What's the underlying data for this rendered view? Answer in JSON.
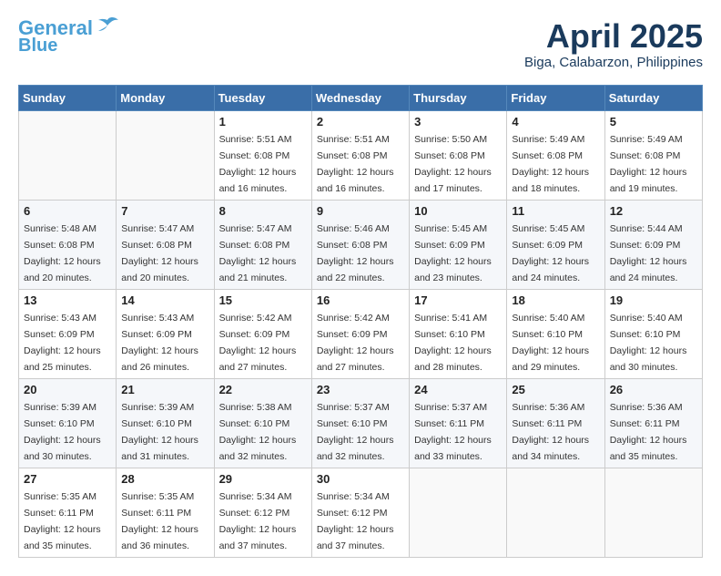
{
  "header": {
    "logo_line1": "General",
    "logo_line2": "Blue",
    "month_title": "April 2025",
    "location": "Biga, Calabarzon, Philippines"
  },
  "weekdays": [
    "Sunday",
    "Monday",
    "Tuesday",
    "Wednesday",
    "Thursday",
    "Friday",
    "Saturday"
  ],
  "weeks": [
    [
      {
        "day": "",
        "sunrise": "",
        "sunset": "",
        "daylight": ""
      },
      {
        "day": "",
        "sunrise": "",
        "sunset": "",
        "daylight": ""
      },
      {
        "day": "1",
        "sunrise": "Sunrise: 5:51 AM",
        "sunset": "Sunset: 6:08 PM",
        "daylight": "Daylight: 12 hours and 16 minutes."
      },
      {
        "day": "2",
        "sunrise": "Sunrise: 5:51 AM",
        "sunset": "Sunset: 6:08 PM",
        "daylight": "Daylight: 12 hours and 16 minutes."
      },
      {
        "day": "3",
        "sunrise": "Sunrise: 5:50 AM",
        "sunset": "Sunset: 6:08 PM",
        "daylight": "Daylight: 12 hours and 17 minutes."
      },
      {
        "day": "4",
        "sunrise": "Sunrise: 5:49 AM",
        "sunset": "Sunset: 6:08 PM",
        "daylight": "Daylight: 12 hours and 18 minutes."
      },
      {
        "day": "5",
        "sunrise": "Sunrise: 5:49 AM",
        "sunset": "Sunset: 6:08 PM",
        "daylight": "Daylight: 12 hours and 19 minutes."
      }
    ],
    [
      {
        "day": "6",
        "sunrise": "Sunrise: 5:48 AM",
        "sunset": "Sunset: 6:08 PM",
        "daylight": "Daylight: 12 hours and 20 minutes."
      },
      {
        "day": "7",
        "sunrise": "Sunrise: 5:47 AM",
        "sunset": "Sunset: 6:08 PM",
        "daylight": "Daylight: 12 hours and 20 minutes."
      },
      {
        "day": "8",
        "sunrise": "Sunrise: 5:47 AM",
        "sunset": "Sunset: 6:08 PM",
        "daylight": "Daylight: 12 hours and 21 minutes."
      },
      {
        "day": "9",
        "sunrise": "Sunrise: 5:46 AM",
        "sunset": "Sunset: 6:08 PM",
        "daylight": "Daylight: 12 hours and 22 minutes."
      },
      {
        "day": "10",
        "sunrise": "Sunrise: 5:45 AM",
        "sunset": "Sunset: 6:09 PM",
        "daylight": "Daylight: 12 hours and 23 minutes."
      },
      {
        "day": "11",
        "sunrise": "Sunrise: 5:45 AM",
        "sunset": "Sunset: 6:09 PM",
        "daylight": "Daylight: 12 hours and 24 minutes."
      },
      {
        "day": "12",
        "sunrise": "Sunrise: 5:44 AM",
        "sunset": "Sunset: 6:09 PM",
        "daylight": "Daylight: 12 hours and 24 minutes."
      }
    ],
    [
      {
        "day": "13",
        "sunrise": "Sunrise: 5:43 AM",
        "sunset": "Sunset: 6:09 PM",
        "daylight": "Daylight: 12 hours and 25 minutes."
      },
      {
        "day": "14",
        "sunrise": "Sunrise: 5:43 AM",
        "sunset": "Sunset: 6:09 PM",
        "daylight": "Daylight: 12 hours and 26 minutes."
      },
      {
        "day": "15",
        "sunrise": "Sunrise: 5:42 AM",
        "sunset": "Sunset: 6:09 PM",
        "daylight": "Daylight: 12 hours and 27 minutes."
      },
      {
        "day": "16",
        "sunrise": "Sunrise: 5:42 AM",
        "sunset": "Sunset: 6:09 PM",
        "daylight": "Daylight: 12 hours and 27 minutes."
      },
      {
        "day": "17",
        "sunrise": "Sunrise: 5:41 AM",
        "sunset": "Sunset: 6:10 PM",
        "daylight": "Daylight: 12 hours and 28 minutes."
      },
      {
        "day": "18",
        "sunrise": "Sunrise: 5:40 AM",
        "sunset": "Sunset: 6:10 PM",
        "daylight": "Daylight: 12 hours and 29 minutes."
      },
      {
        "day": "19",
        "sunrise": "Sunrise: 5:40 AM",
        "sunset": "Sunset: 6:10 PM",
        "daylight": "Daylight: 12 hours and 30 minutes."
      }
    ],
    [
      {
        "day": "20",
        "sunrise": "Sunrise: 5:39 AM",
        "sunset": "Sunset: 6:10 PM",
        "daylight": "Daylight: 12 hours and 30 minutes."
      },
      {
        "day": "21",
        "sunrise": "Sunrise: 5:39 AM",
        "sunset": "Sunset: 6:10 PM",
        "daylight": "Daylight: 12 hours and 31 minutes."
      },
      {
        "day": "22",
        "sunrise": "Sunrise: 5:38 AM",
        "sunset": "Sunset: 6:10 PM",
        "daylight": "Daylight: 12 hours and 32 minutes."
      },
      {
        "day": "23",
        "sunrise": "Sunrise: 5:37 AM",
        "sunset": "Sunset: 6:10 PM",
        "daylight": "Daylight: 12 hours and 32 minutes."
      },
      {
        "day": "24",
        "sunrise": "Sunrise: 5:37 AM",
        "sunset": "Sunset: 6:11 PM",
        "daylight": "Daylight: 12 hours and 33 minutes."
      },
      {
        "day": "25",
        "sunrise": "Sunrise: 5:36 AM",
        "sunset": "Sunset: 6:11 PM",
        "daylight": "Daylight: 12 hours and 34 minutes."
      },
      {
        "day": "26",
        "sunrise": "Sunrise: 5:36 AM",
        "sunset": "Sunset: 6:11 PM",
        "daylight": "Daylight: 12 hours and 35 minutes."
      }
    ],
    [
      {
        "day": "27",
        "sunrise": "Sunrise: 5:35 AM",
        "sunset": "Sunset: 6:11 PM",
        "daylight": "Daylight: 12 hours and 35 minutes."
      },
      {
        "day": "28",
        "sunrise": "Sunrise: 5:35 AM",
        "sunset": "Sunset: 6:11 PM",
        "daylight": "Daylight: 12 hours and 36 minutes."
      },
      {
        "day": "29",
        "sunrise": "Sunrise: 5:34 AM",
        "sunset": "Sunset: 6:12 PM",
        "daylight": "Daylight: 12 hours and 37 minutes."
      },
      {
        "day": "30",
        "sunrise": "Sunrise: 5:34 AM",
        "sunset": "Sunset: 6:12 PM",
        "daylight": "Daylight: 12 hours and 37 minutes."
      },
      {
        "day": "",
        "sunrise": "",
        "sunset": "",
        "daylight": ""
      },
      {
        "day": "",
        "sunrise": "",
        "sunset": "",
        "daylight": ""
      },
      {
        "day": "",
        "sunrise": "",
        "sunset": "",
        "daylight": ""
      }
    ]
  ]
}
